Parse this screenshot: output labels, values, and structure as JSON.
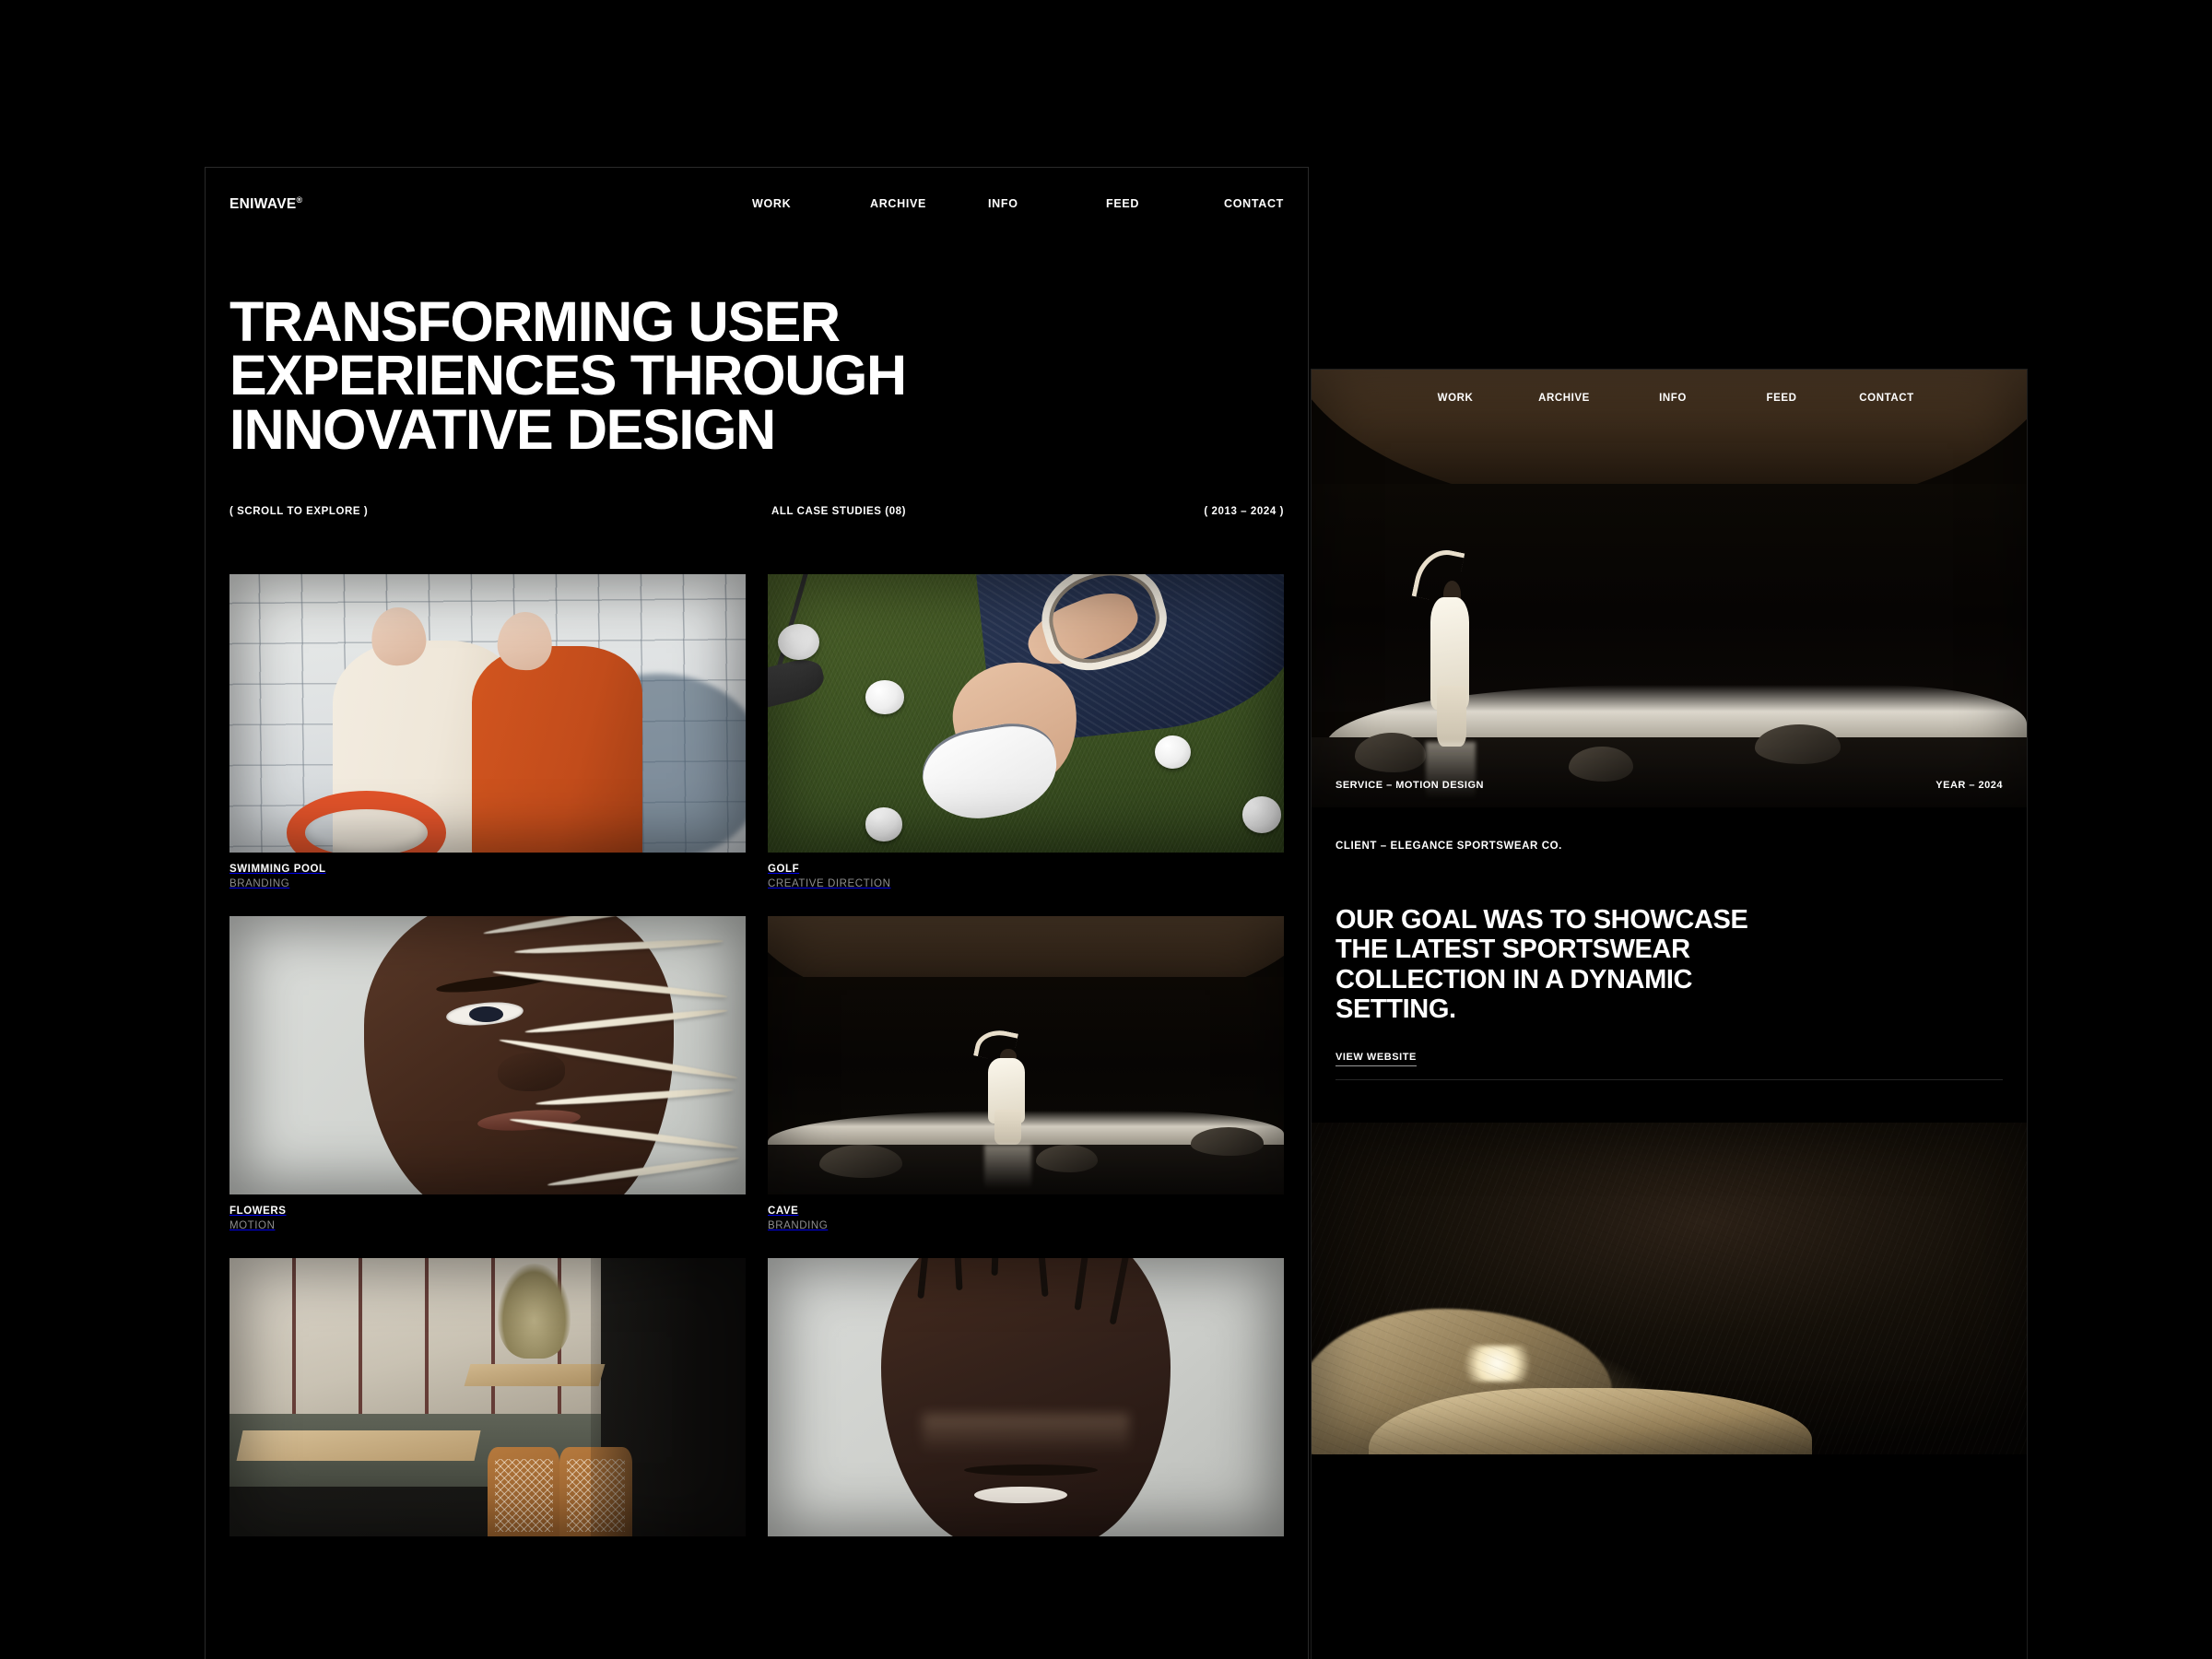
{
  "brand": {
    "name": "ENIWAVE",
    "mark": "®"
  },
  "nav": {
    "items": [
      {
        "label": "WORK"
      },
      {
        "label": "ARCHIVE"
      },
      {
        "label": "INFO"
      },
      {
        "label": "FEED"
      },
      {
        "label": "CONTACT"
      }
    ]
  },
  "hero": {
    "title": "TRANSFORMING USER\nEXPERIENCES THROUGH\nINNOVATIVE DESIGN",
    "scroll_hint": "( SCROLL TO EXPLORE )",
    "case_studies": "ALL CASE STUDIES (08)",
    "years": "( 2013 – 2024 )"
  },
  "projects": [
    {
      "title": "SWIMMING POOL",
      "category": "BRANDING"
    },
    {
      "title": "GOLF",
      "category": "CREATIVE DIRECTION"
    },
    {
      "title": "FLOWERS",
      "category": "MOTION"
    },
    {
      "title": "CAVE",
      "category": "BRANDING"
    },
    {
      "title": "",
      "category": ""
    },
    {
      "title": "",
      "category": ""
    }
  ],
  "case_study": {
    "service": "SERVICE – MOTION DESIGN",
    "year": "YEAR – 2024",
    "client": "CLIENT – ELEGANCE SPORTSWEAR CO.",
    "headline": "OUR GOAL WAS TO SHOWCASE\nTHE LATEST SPORTSWEAR\nCOLLECTION IN A DYNAMIC\nSETTING.",
    "link_label": "VIEW WEBSITE"
  },
  "colors": {
    "background": "#000000",
    "text": "#ffffff",
    "muted": "#8e8e8e",
    "rule": "#262626"
  }
}
